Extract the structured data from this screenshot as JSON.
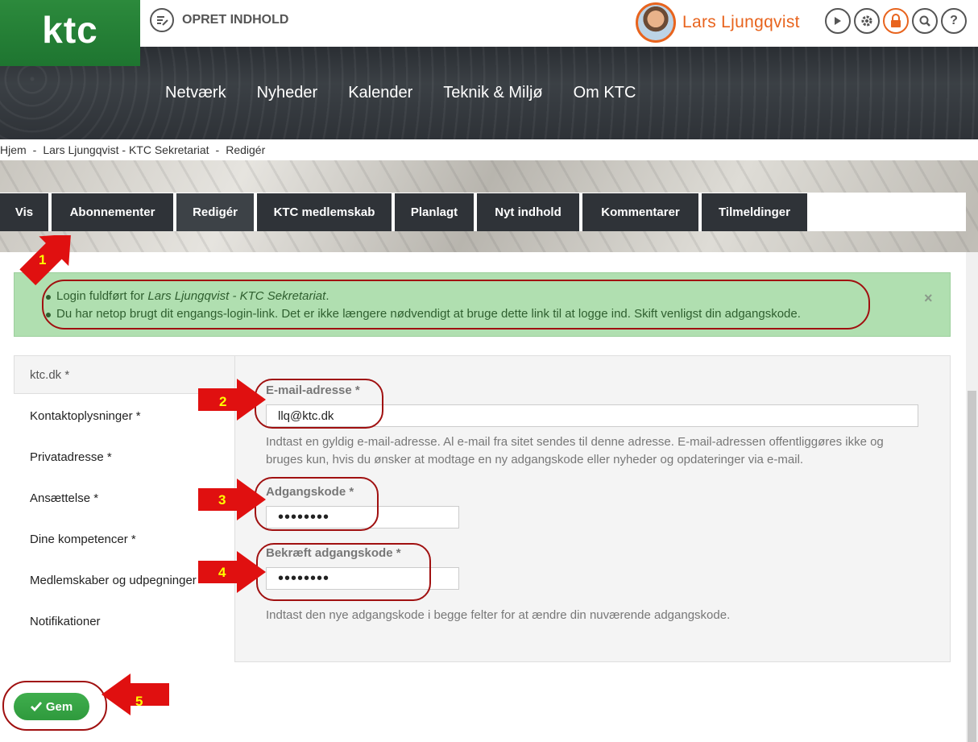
{
  "brand": {
    "logo_text": "ktc",
    "color": "#2c8a3c"
  },
  "topbar": {
    "create_label": "OPRET INDHOLD",
    "create_icon": "edit-note-icon",
    "user_name": "Lars  Ljungqvist",
    "user_color": "#e8641e",
    "icons": [
      "arrow-right-icon",
      "gear-icon",
      "lock-icon",
      "search-icon",
      "help-icon"
    ]
  },
  "nav": [
    "Netværk",
    "Nyheder",
    "Kalender",
    "Teknik & Miljø",
    "Om KTC"
  ],
  "breadcrumb": [
    "Hjem",
    "Lars Ljungqvist - KTC Sekretariat",
    "Redigér"
  ],
  "tabs": [
    "Vis",
    "Abonnementer",
    "Redigér",
    "KTC medlemskab",
    "Planlagt",
    "Nyt indhold",
    "Kommentarer",
    "Tilmeldinger"
  ],
  "active_tab": "Redigér",
  "alert": {
    "line1_prefix": "Login fuldført for ",
    "line1_em": "Lars Ljungqvist - KTC Sekretariat",
    "line1_suffix": ".",
    "line2": "Du har netop brugt dit engangs-login-link. Det er ikke længere nødvendigt at bruge dette link til at logge ind. Skift venligst din adgangskode.",
    "close": "×"
  },
  "vertical_tabs": [
    "ktc.dk *",
    "Kontaktoplysninger *",
    "Privatadresse *",
    "Ansættelse *",
    "Dine kompetencer *",
    "Medlemskaber og udpegninger",
    "Notifikationer"
  ],
  "form": {
    "email_label": "E-mail-adresse *",
    "email_value": "llq@ktc.dk",
    "email_help": "Indtast en gyldig e-mail-adresse. Al e-mail fra sitet sendes til denne adresse. E-mail-adressen offentliggøres ikke og bruges kun, hvis du ønsker at modtage en ny adgangskode eller nyheder og opdateringer via e-mail.",
    "password_label": "Adgangskode *",
    "password_value": "••••••••",
    "confirm_label": "Bekræft adgangskode *",
    "confirm_value": "••••••••",
    "password_help": "Indtast den nye adgangskode i begge felter for at ændre din nuværende adgangskode."
  },
  "save_label": "Gem",
  "annotations": [
    "1",
    "2",
    "3",
    "4",
    "5"
  ]
}
